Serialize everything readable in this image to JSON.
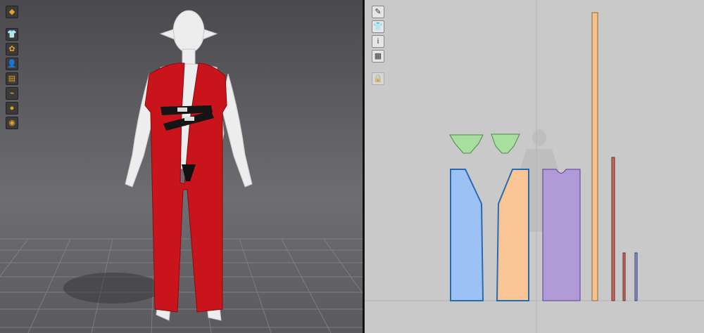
{
  "viewport_3d": {
    "tools": [
      {
        "name": "fabric-render-icon",
        "glyph": "◆"
      },
      {
        "name": "garment-icon",
        "glyph": "👕"
      },
      {
        "name": "sewing-icon",
        "glyph": "✿"
      },
      {
        "name": "avatar-icon",
        "glyph": "👤"
      },
      {
        "name": "texture-icon",
        "glyph": "▤"
      },
      {
        "name": "shoe-icon",
        "glyph": "⌁"
      },
      {
        "name": "avatar-color-icon",
        "glyph": "●"
      },
      {
        "name": "world-icon",
        "glyph": "◉"
      }
    ]
  },
  "viewport_2d": {
    "tools": [
      {
        "name": "brush-icon",
        "glyph": "✎",
        "disabled": false
      },
      {
        "name": "shirt-icon",
        "glyph": "👕",
        "disabled": false
      },
      {
        "name": "info-icon",
        "glyph": "i",
        "disabled": false
      },
      {
        "name": "color-palette-icon",
        "glyph": "▦",
        "disabled": false
      },
      {
        "name": "lock-icon",
        "glyph": "🔒",
        "disabled": true
      }
    ]
  },
  "colors": {
    "garment_red": "#c8141a",
    "piece_blue": "#9cc2f5",
    "piece_orange": "#f9c594",
    "piece_purple": "#b09ad8",
    "piece_green": "#a8dea0",
    "piece_tan": "#f5c38a",
    "strip_red": "#c86a5a",
    "strip_blue": "#8a9ad0"
  }
}
